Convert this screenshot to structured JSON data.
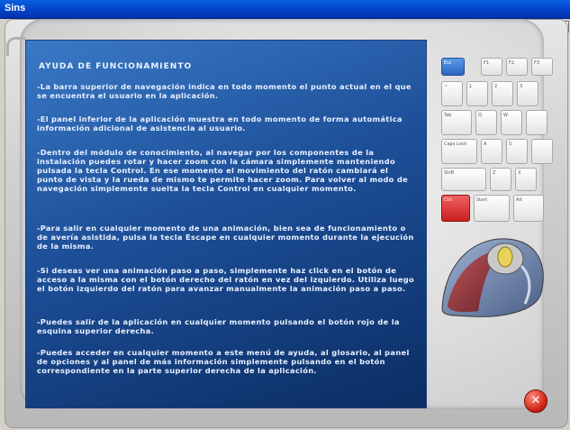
{
  "window": {
    "title": "Sins",
    "close_glyph": "✕"
  },
  "help": {
    "heading": "AYUDA DE FUNCIONAMIENTO",
    "paragraphs": [
      "-La barra superior de navegación indica en todo momento el punto actual en el que se encuentra el usuario en la aplicación.",
      "-El panel inferior de la aplicación muestra en todo momento de forma automática información adicional de asistencia al usuario.",
      "-Dentro del módulo de conocimiento, al navegar por los componentes de la instalación puedes rotar y hacer zoom con la cámara simplemente manteniendo pulsada la tecla Control. En ese momento el movimiento del ratón cambiará el punto de vista y la rueda de mismo te permite hacer zoom. Para volver al modo de navegación simplemente suelta la tecla Control en cualquier momento.",
      "-Para salir en cualquier momento de una animación, bien sea de funcionamiento o de avería asistida, pulsa la tecla Escape en cualquier momento durante la ejecución de la misma.",
      "-Si deseas ver una animación paso a paso, simplemente haz click en el botón de acceso a la misma con el botón derecho del ratón en vez del izquierdo. Utiliza luego el botón izquierdo del ratón para avanzar manualmente la animación paso a paso.",
      "-Puedes salir de la aplicación en cualquier momento pulsando el botón rojo de la esquina superior derecha.",
      "-Puedes acceder en cualquier momento a este menú de ayuda, al glosario, al panel de opciones y al panel de más información simplemente pulsando en el botón correspondiente en la parte superior derecha de la aplicación."
    ]
  },
  "keyboard": {
    "keys": [
      "Esc",
      "F1",
      "F2",
      "F3",
      "~",
      "1",
      "2",
      "3",
      "Tab",
      "Q",
      "W",
      "Caps Lock",
      "A",
      "S",
      "Shift",
      "Z",
      "X",
      "Ctrl",
      "Start",
      "Alt"
    ]
  },
  "exit_button": {
    "glyph": "✕"
  },
  "colors": {
    "panel_top": "#3a79c6",
    "panel_bottom": "#0b2d63",
    "exit": "#d32a1a"
  }
}
